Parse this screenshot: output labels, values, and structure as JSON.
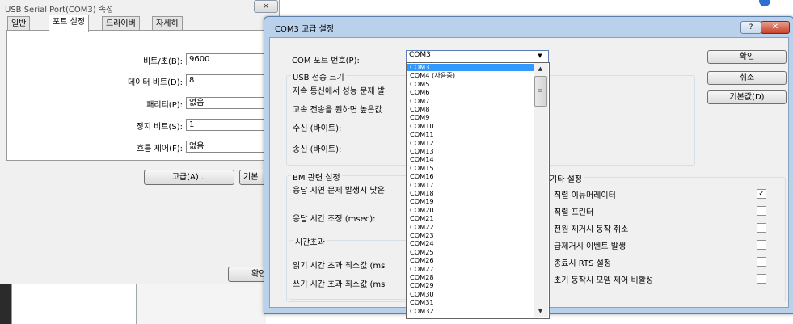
{
  "background_window": {
    "info_icon": "info-icon"
  },
  "props_dialog": {
    "title": "USB Serial Port(COM3) 속성",
    "close_glyph": "⨯",
    "tabs": [
      "일반",
      "포트 설정",
      "드라이버",
      "자세히"
    ],
    "active_tab": "포트 설정",
    "fields": [
      {
        "label": "비트/초(B):",
        "value": "9600"
      },
      {
        "label": "데이터 비트(D):",
        "value": "8"
      },
      {
        "label": "패리티(P):",
        "value": "없음"
      },
      {
        "label": "정지 비트(S):",
        "value": "1"
      },
      {
        "label": "흐름 제어(F):",
        "value": "없음"
      }
    ],
    "advanced_button": "고급(A)...",
    "defaults_button_partial": "기본",
    "ok_button_partial": "확인"
  },
  "adv_dialog": {
    "title": "COM3 고급 설정",
    "help_glyph": "?",
    "close_glyph": "✕",
    "com_port_label": "COM 포트 번호(P):",
    "com_port_value": "COM3",
    "usb_group_title": "USB 전송 크기",
    "usb_line1": "저속 통신에서 성능 문제 발",
    "usb_line2": "고속 전송을 원하면 높은값",
    "receive_label": "수신 (바이트):",
    "send_label": "송신 (바이트):",
    "bm_group_title": "BM 관련 설정",
    "bm_line1": "응답 지연 문제 발생시 낮은",
    "latency_label": "응답 시간 조정 (msec):",
    "timeout_group_title": "시간초과",
    "read_timeout_label": "읽기 시간 초과 최소값 (ms",
    "write_timeout_label": "쓰기 시간 초과 최소값 (ms",
    "ok_button": "확인",
    "cancel_button": "취소",
    "defaults_button": "기본값(D)",
    "misc_group_title": "기타 설정",
    "misc_options": [
      {
        "label": "직렬 이뉴머레이터",
        "checked": true
      },
      {
        "label": "직렬 프린터",
        "checked": false
      },
      {
        "label": "전원 제거시 동작 취소",
        "checked": false
      },
      {
        "label": "급제거시 이벤트 발생",
        "checked": false
      },
      {
        "label": "종료시 RTS 설정",
        "checked": false
      },
      {
        "label": "초기 동작시 모뎀 제어 비활성",
        "checked": false
      }
    ],
    "check_glyph": "✓",
    "dropdown_arrow": "▼",
    "scroll_up": "▲",
    "scroll_down": "▼",
    "scroll_grip": "≡",
    "com_options": [
      "COM3",
      "COM4 (사용중)",
      "COM5",
      "COM6",
      "COM7",
      "COM8",
      "COM9",
      "COM10",
      "COM11",
      "COM12",
      "COM13",
      "COM14",
      "COM15",
      "COM16",
      "COM17",
      "COM18",
      "COM19",
      "COM20",
      "COM21",
      "COM22",
      "COM23",
      "COM24",
      "COM25",
      "COM26",
      "COM27",
      "COM28",
      "COM29",
      "COM30",
      "COM31",
      "COM32"
    ],
    "selected_option": "COM3"
  },
  "colors": {
    "title_bar": "#b9d1ea",
    "selection": "#3399ff",
    "close_red": "#c8402a"
  }
}
